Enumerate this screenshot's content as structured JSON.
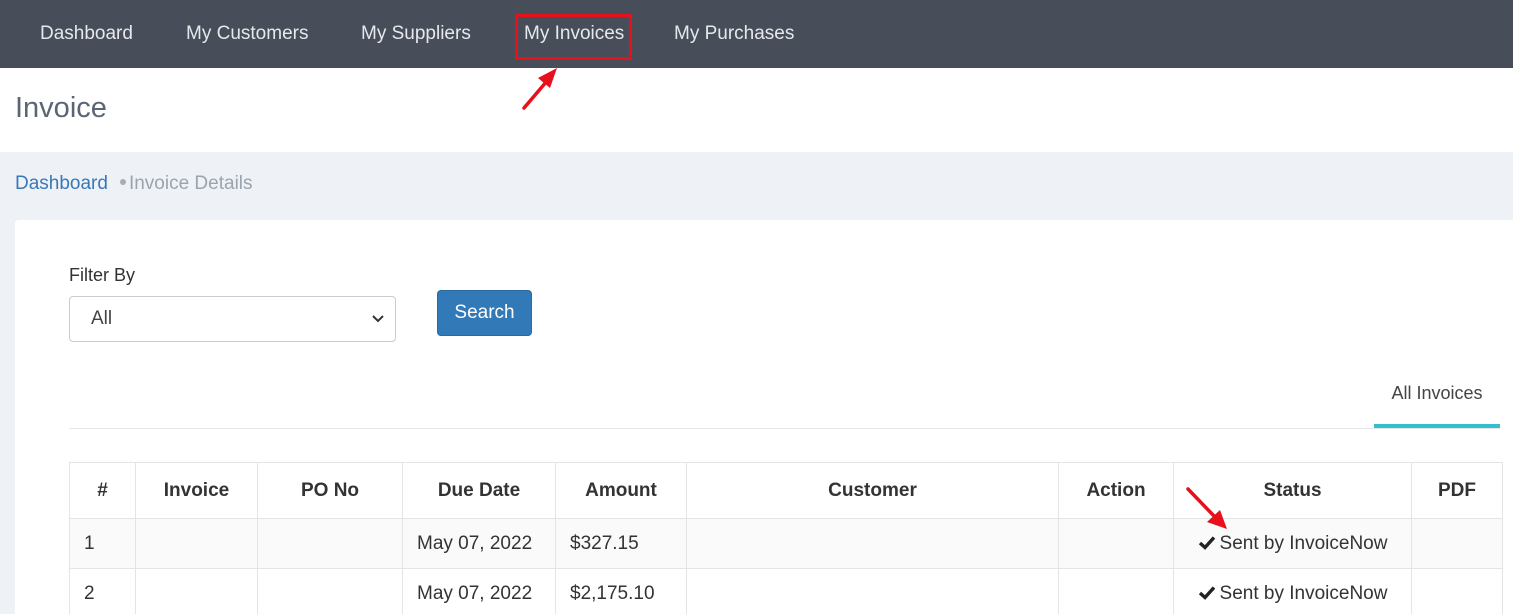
{
  "nav": {
    "items": [
      {
        "label": "Dashboard"
      },
      {
        "label": "My Customers"
      },
      {
        "label": "My Suppliers"
      },
      {
        "label": "My Invoices"
      },
      {
        "label": "My Purchases"
      }
    ]
  },
  "page": {
    "title": "Invoice"
  },
  "breadcrumb": {
    "home": "Dashboard",
    "current": "Invoice Details"
  },
  "filter": {
    "label": "Filter By",
    "selected": "All",
    "chevron_icon": "chevron-down-icon"
  },
  "search_button": "Search",
  "tabs": {
    "all_invoices": "All Invoices"
  },
  "table": {
    "headers": [
      "#",
      "Invoice",
      "PO No",
      "Due Date",
      "Amount",
      "Customer",
      "Action",
      "Status",
      "PDF"
    ],
    "rows": [
      {
        "num": "1",
        "invoice": "",
        "po_no": "",
        "due_date": "May 07, 2022",
        "amount": "$327.15",
        "customer": "",
        "action": "",
        "status": "Sent by InvoiceNow",
        "pdf": ""
      },
      {
        "num": "2",
        "invoice": "",
        "po_no": "",
        "due_date": "May 07, 2022",
        "amount": "$2,175.10",
        "customer": "",
        "action": "",
        "status": "Sent by InvoiceNow",
        "pdf": ""
      }
    ],
    "status_icon": "checkmark-icon"
  },
  "colors": {
    "navbar": "#474e59",
    "primary_button": "#3279b7",
    "tab_active": "#35bfce",
    "annotation": "#e8101a",
    "link": "#3a78b5"
  }
}
